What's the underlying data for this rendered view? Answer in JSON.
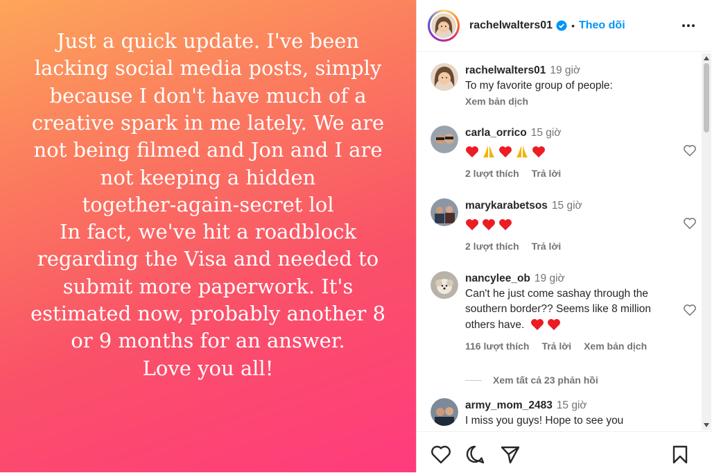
{
  "post": {
    "text": "Just a quick update. I've been\nlacking social media posts, simply\nbecause I don't have much of a\ncreative spark in me lately. We are\nnot being filmed and Jon and I are\nnot keeping a hidden\ntogether-again-secret lol\nIn fact, we've hit a roadblock\nregarding the Visa and needed to\nsubmit more paperwork. It's\nestimated now, probably another 8\nor 9 months for an answer.\nLove you all!"
  },
  "header": {
    "username": "rachelwalters01",
    "dot": "•",
    "follow_label": "Theo dõi"
  },
  "caption": {
    "username": "rachelwalters01",
    "time": "19 giờ",
    "text": "To my favorite group of people:",
    "translate": "Xem bản dịch"
  },
  "comments": [
    {
      "username": "carla_orrico",
      "time": "15 giờ",
      "text": "",
      "emoji": [
        "heart",
        "pray",
        "heart",
        "pray",
        "heart"
      ],
      "likes": "2 lượt thích",
      "reply": "Trả lời",
      "translate": ""
    },
    {
      "username": "marykarabetsos",
      "time": "15 giờ",
      "text": "",
      "emoji": [
        "heart",
        "heart",
        "heart"
      ],
      "likes": "2 lượt thích",
      "reply": "Trả lời",
      "translate": ""
    },
    {
      "username": "nancylee_ob",
      "time": "19 giờ",
      "text": "Can't he just come sashay through the southern border?? Seems like 8 million others have.",
      "emoji": [
        "heart",
        "heart"
      ],
      "likes": "116 lượt thích",
      "reply": "Trả lời",
      "translate": "Xem bản dịch"
    },
    {
      "username": "army_mom_2483",
      "time": "15 giờ",
      "text": "I miss you guys! Hope to see you",
      "emoji": [],
      "likes": "",
      "reply": "",
      "translate": ""
    }
  ],
  "replies": {
    "label": "Xem tất cả 23 phản hồi"
  },
  "colors": {
    "follow": "#0095f6",
    "heart": "#ed1c24",
    "muted": "#737373"
  },
  "icons": [
    "verified-icon",
    "more-icon",
    "heart-icon",
    "comment-icon",
    "share-icon",
    "bookmark-icon",
    "pray-emoji"
  ]
}
